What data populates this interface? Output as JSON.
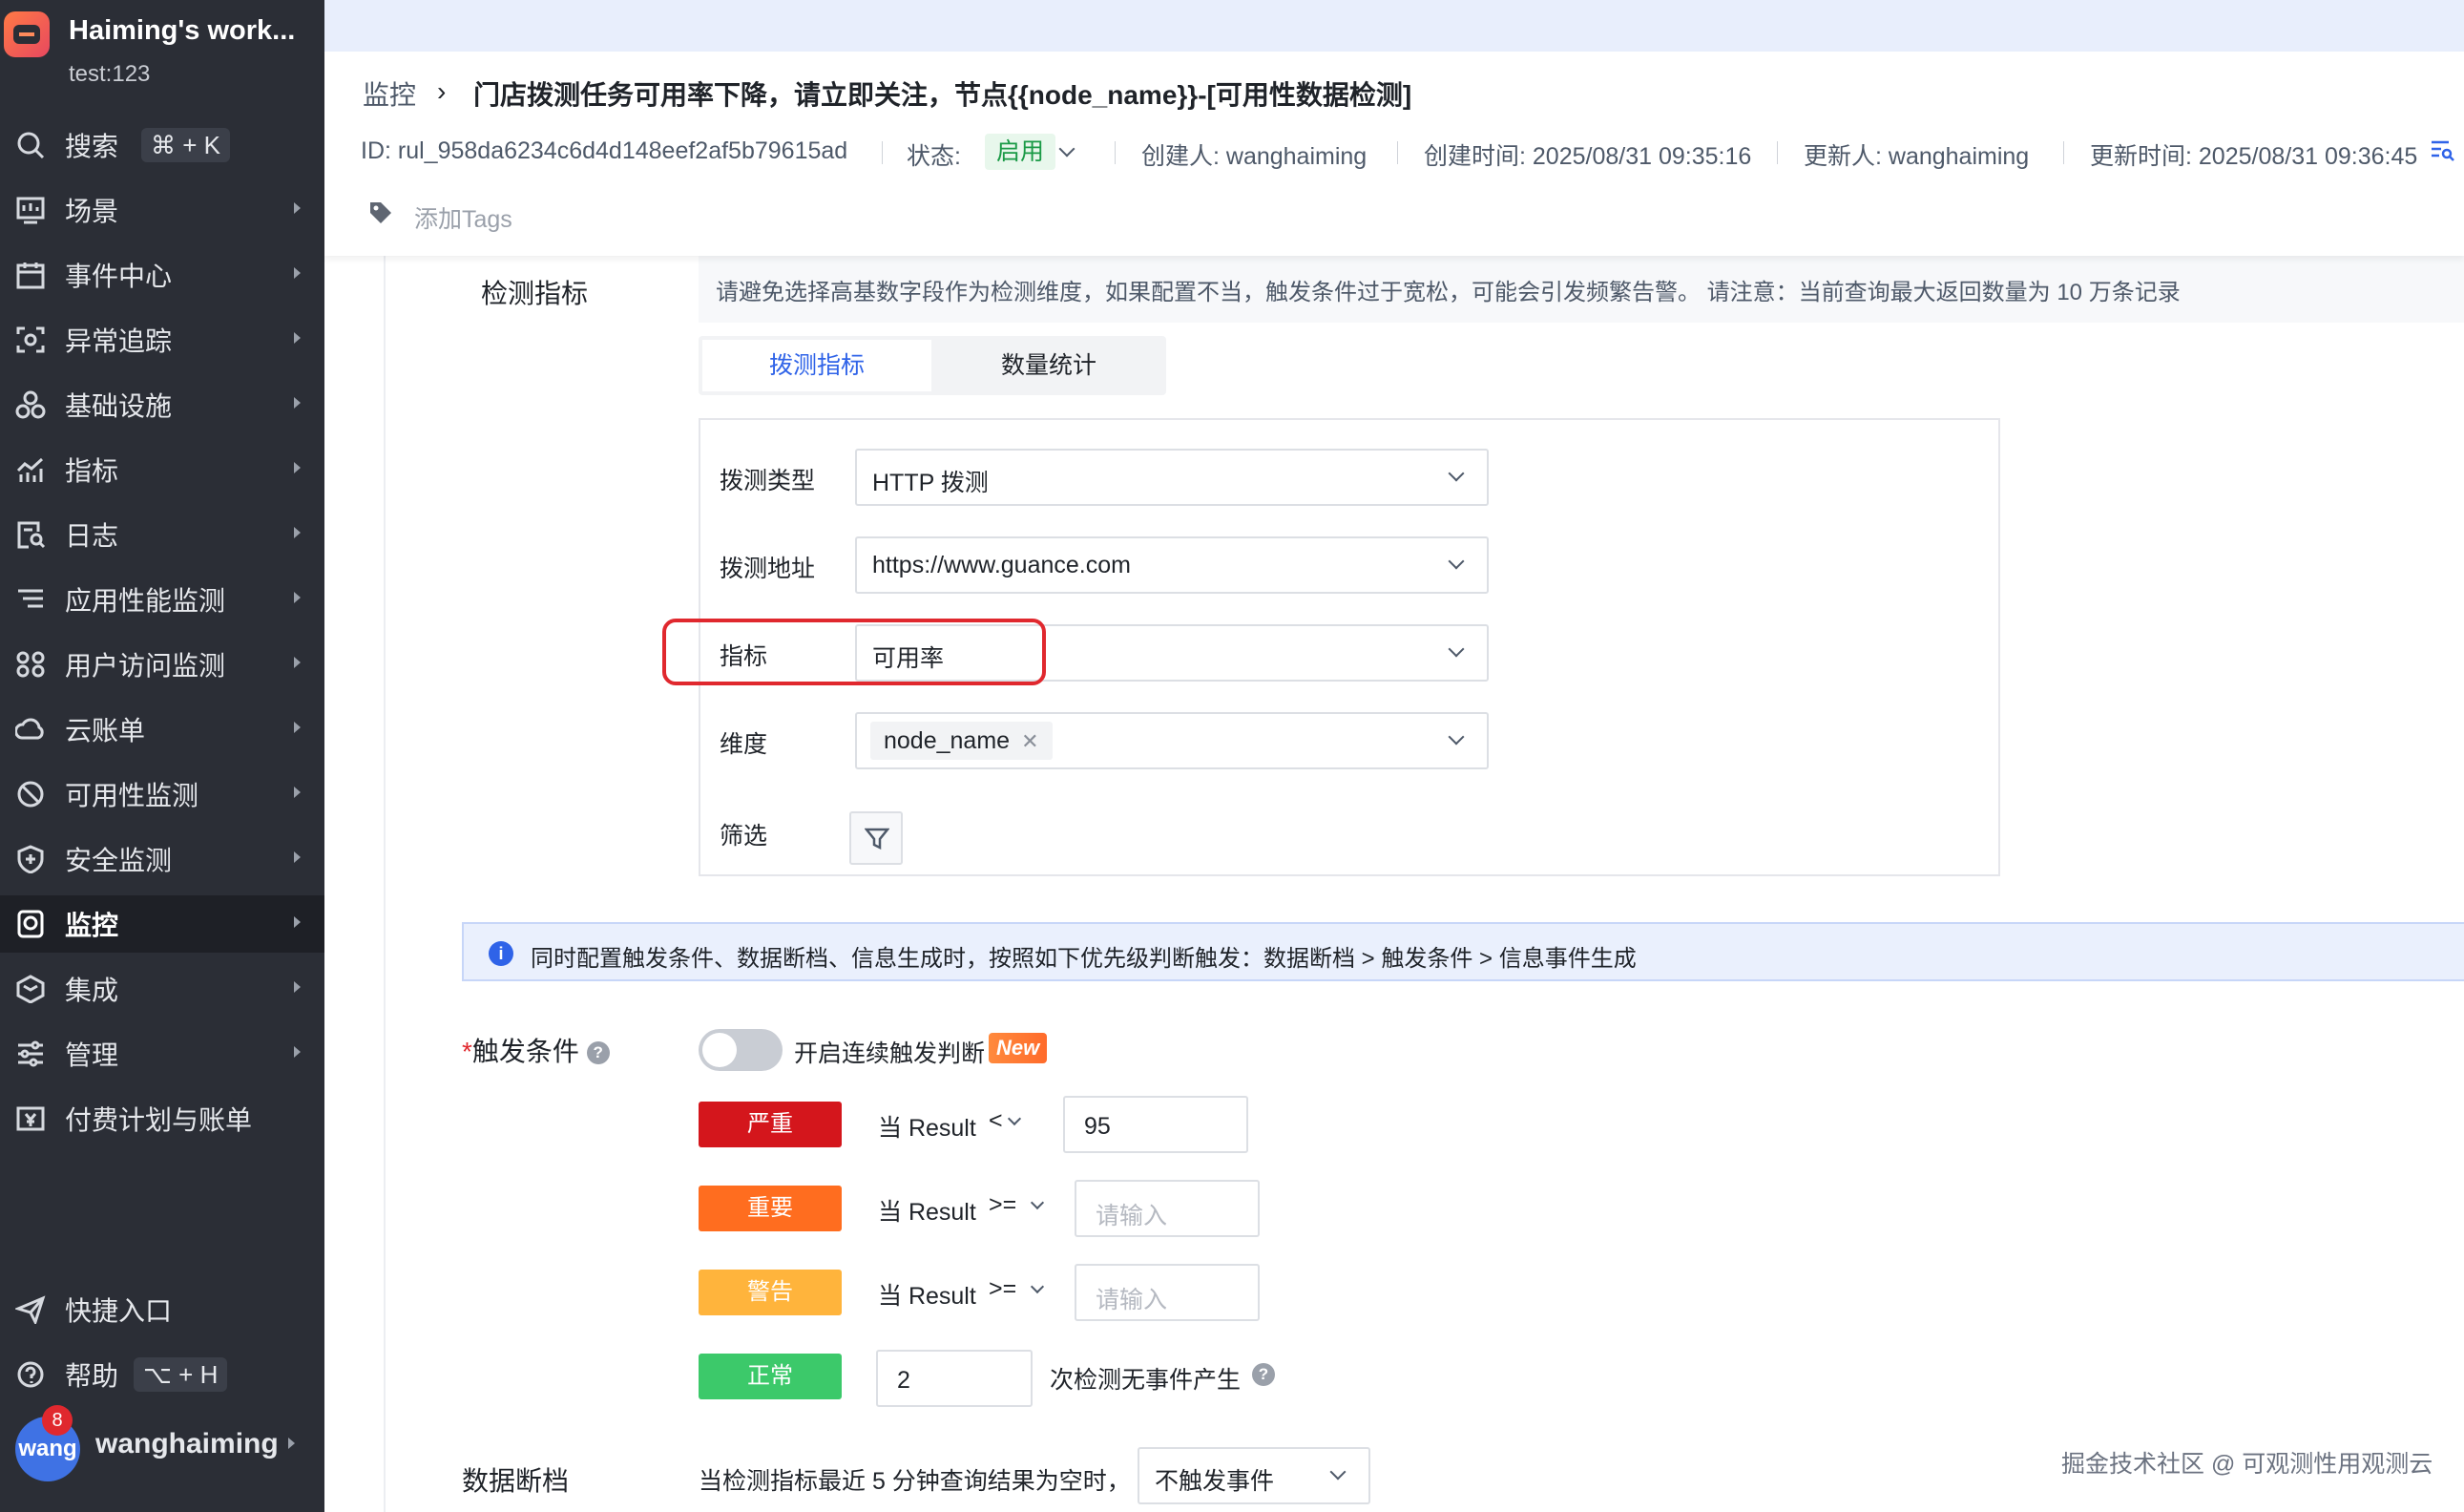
{
  "workspace": {
    "title": "Haiming's work...",
    "subtitle": "test:123"
  },
  "sidebar": {
    "items": [
      {
        "label": "搜索",
        "icon": "search-icon",
        "shortcut": "⌘ + K"
      },
      {
        "label": "场景",
        "icon": "dashboard-icon"
      },
      {
        "label": "事件中心",
        "icon": "calendar-icon"
      },
      {
        "label": "异常追踪",
        "icon": "scan-icon"
      },
      {
        "label": "基础设施",
        "icon": "infrastructure-icon"
      },
      {
        "label": "指标",
        "icon": "chart-icon"
      },
      {
        "label": "日志",
        "icon": "log-icon"
      },
      {
        "label": "应用性能监测",
        "icon": "apm-icon"
      },
      {
        "label": "用户访问监测",
        "icon": "rum-icon"
      },
      {
        "label": "云账单",
        "icon": "cloud-bill-icon"
      },
      {
        "label": "可用性监测",
        "icon": "availability-icon"
      },
      {
        "label": "安全监测",
        "icon": "shield-icon"
      },
      {
        "label": "监控",
        "icon": "monitor-icon",
        "active": true
      },
      {
        "label": "集成",
        "icon": "integration-icon"
      },
      {
        "label": "管理",
        "icon": "settings-icon"
      },
      {
        "label": "付费计划与账单",
        "icon": "billing-icon"
      }
    ],
    "bottom": [
      {
        "label": "快捷入口",
        "icon": "send-icon"
      },
      {
        "label": "帮助",
        "icon": "help-icon",
        "shortcut": "⌥ + H"
      }
    ],
    "user": {
      "avatar_text": "wang",
      "badge": "8",
      "name": "wanghaiming"
    }
  },
  "header": {
    "breadcrumb": "监控",
    "title": "门店拨测任务可用率下降，请立即关注，节点{{node_name}}-[可用性数据检测]",
    "id": "ID: rul_958da6234c6d4d148eef2af5b79615ad",
    "status_label": "状态:",
    "status_value": "启用",
    "creator": "创建人: wanghaiming",
    "created_at": "创建时间: 2025/08/31 09:35:16",
    "updater": "更新人: wanghaiming",
    "updated_at": "更新时间: 2025/08/31 09:36:45",
    "add_tags": "添加Tags"
  },
  "detection": {
    "label": "检测指标",
    "hint": "请避免选择高基数字段作为检测维度，如果配置不当，触发条件过于宽松，可能会引发频繁告警。 请注意：当前查询最大返回数量为 10 万条记录",
    "tabs": [
      "拨测指标",
      "数量统计"
    ],
    "fields": {
      "type_label": "拨测类型",
      "type_value": "HTTP 拨测",
      "address_label": "拨测地址",
      "address_value": "https://www.guance.com",
      "metric_label": "指标",
      "metric_value": "可用率",
      "dimension_label": "维度",
      "dimension_chip": "node_name",
      "filter_label": "筛选"
    }
  },
  "info": "同时配置触发条件、数据断档、信息生成时，按照如下优先级判断触发：数据断档 > 触发条件 > 信息事件生成",
  "trigger": {
    "label": "触发条件",
    "switch_label": "开启连续触发判断",
    "new_badge": "New",
    "levels": [
      {
        "name": "严重",
        "color": "#d4161c",
        "cond": "当 Result",
        "op": "<",
        "value": "95",
        "placeholder": ""
      },
      {
        "name": "重要",
        "color": "#ff6d1f",
        "cond": "当 Result",
        "op": ">=",
        "value": "",
        "placeholder": "请输入"
      },
      {
        "name": "警告",
        "color": "#ffb43c",
        "cond": "当 Result",
        "op": ">=",
        "value": "",
        "placeholder": "请输入"
      }
    ],
    "normal": {
      "name": "正常",
      "color": "#3cc96a",
      "count": "2",
      "suffix": "次检测无事件产生"
    }
  },
  "data_gap": {
    "label": "数据断档",
    "text": "当检测指标最近 5 分钟查询结果为空时，",
    "select_value": "不触发事件"
  },
  "watermark": "掘金技术社区 @ 可观测性用观测云"
}
